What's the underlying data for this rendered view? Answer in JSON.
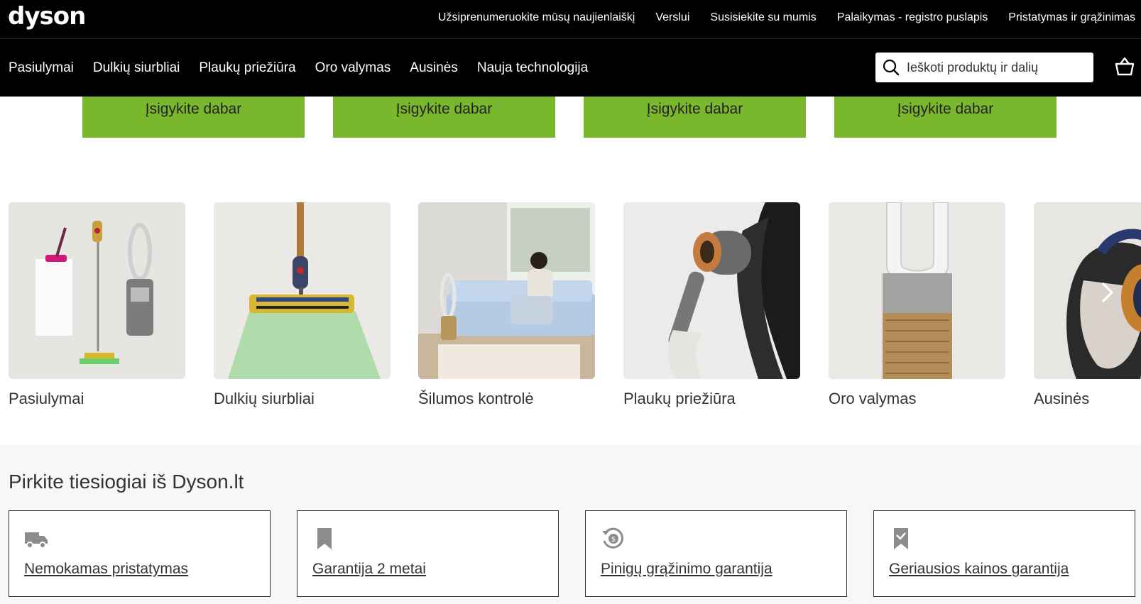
{
  "brand": {
    "logo_text": "dyson"
  },
  "utility_nav": [
    "Užsiprenumeruokite mūsų naujienlaiškį",
    "Verslui",
    "Susisiekite su mumis",
    "Palaikymas - registro puslapis",
    "Pristatymas ir grąžinimas"
  ],
  "main_nav": [
    "Pasiulymai",
    "Dulkių siurbliai",
    "Plaukų priežiūra",
    "Oro valymas",
    "Ausinės",
    "Nauja technologija"
  ],
  "search": {
    "placeholder": "Ieškoti produktų ir dalių"
  },
  "buy_buttons": [
    "Įsigykite dabar",
    "Įsigykite dabar",
    "Įsigykite dabar",
    "Įsigykite dabar"
  ],
  "categories": [
    {
      "label": "Pasiulymai",
      "image": "product-lineup-image"
    },
    {
      "label": "Dulkių siurbliai",
      "image": "vacuum-laser-head-image"
    },
    {
      "label": "Šilumos kontrolė",
      "image": "woman-on-sofa-with-purifier-image"
    },
    {
      "label": "Plaukų priežiūra",
      "image": "hair-dryer-image"
    },
    {
      "label": "Oro valymas",
      "image": "air-purifier-image"
    },
    {
      "label": "Ausinės",
      "image": "headphones-model-image"
    }
  ],
  "direct": {
    "title": "Pirkite tiesiogiai iš Dyson.lt",
    "features": [
      {
        "label": "Nemokamas pristatymas",
        "icon": "truck-icon"
      },
      {
        "label": "Garantija 2 metai",
        "icon": "bookmark-icon"
      },
      {
        "label": "Pinigų grąžinimo garantija",
        "icon": "money-back-icon"
      },
      {
        "label": "Geriausios kainos garantija",
        "icon": "price-check-icon"
      }
    ]
  },
  "colors": {
    "header_bg": "#000000",
    "accent_green": "#79b82c",
    "section_bg": "#f7f7f7"
  }
}
